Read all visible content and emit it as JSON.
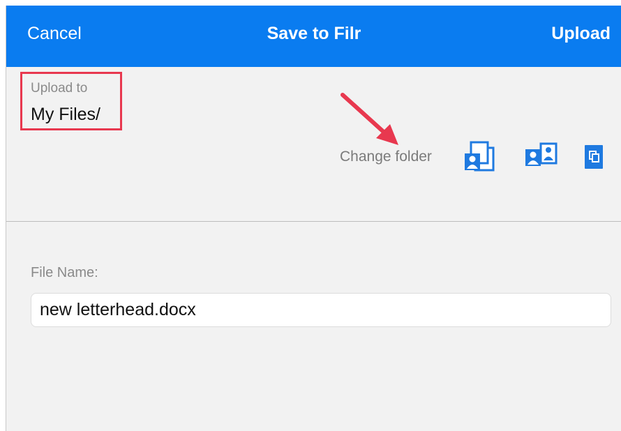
{
  "navbar": {
    "cancel_label": "Cancel",
    "title": "Save to Filr",
    "upload_label": "Upload",
    "background_color": "#0a7cf0"
  },
  "destination": {
    "label": "Upload to",
    "path": "My Files/"
  },
  "change_folder": {
    "label": "Change folder",
    "icons": [
      "my-files-folder-icon",
      "shared-with-me-folder-icon",
      "net-folders-icon"
    ]
  },
  "file_name": {
    "label": "File Name:",
    "value": "new letterhead.docx"
  },
  "annotation": {
    "highlight_color": "#e8384f"
  }
}
